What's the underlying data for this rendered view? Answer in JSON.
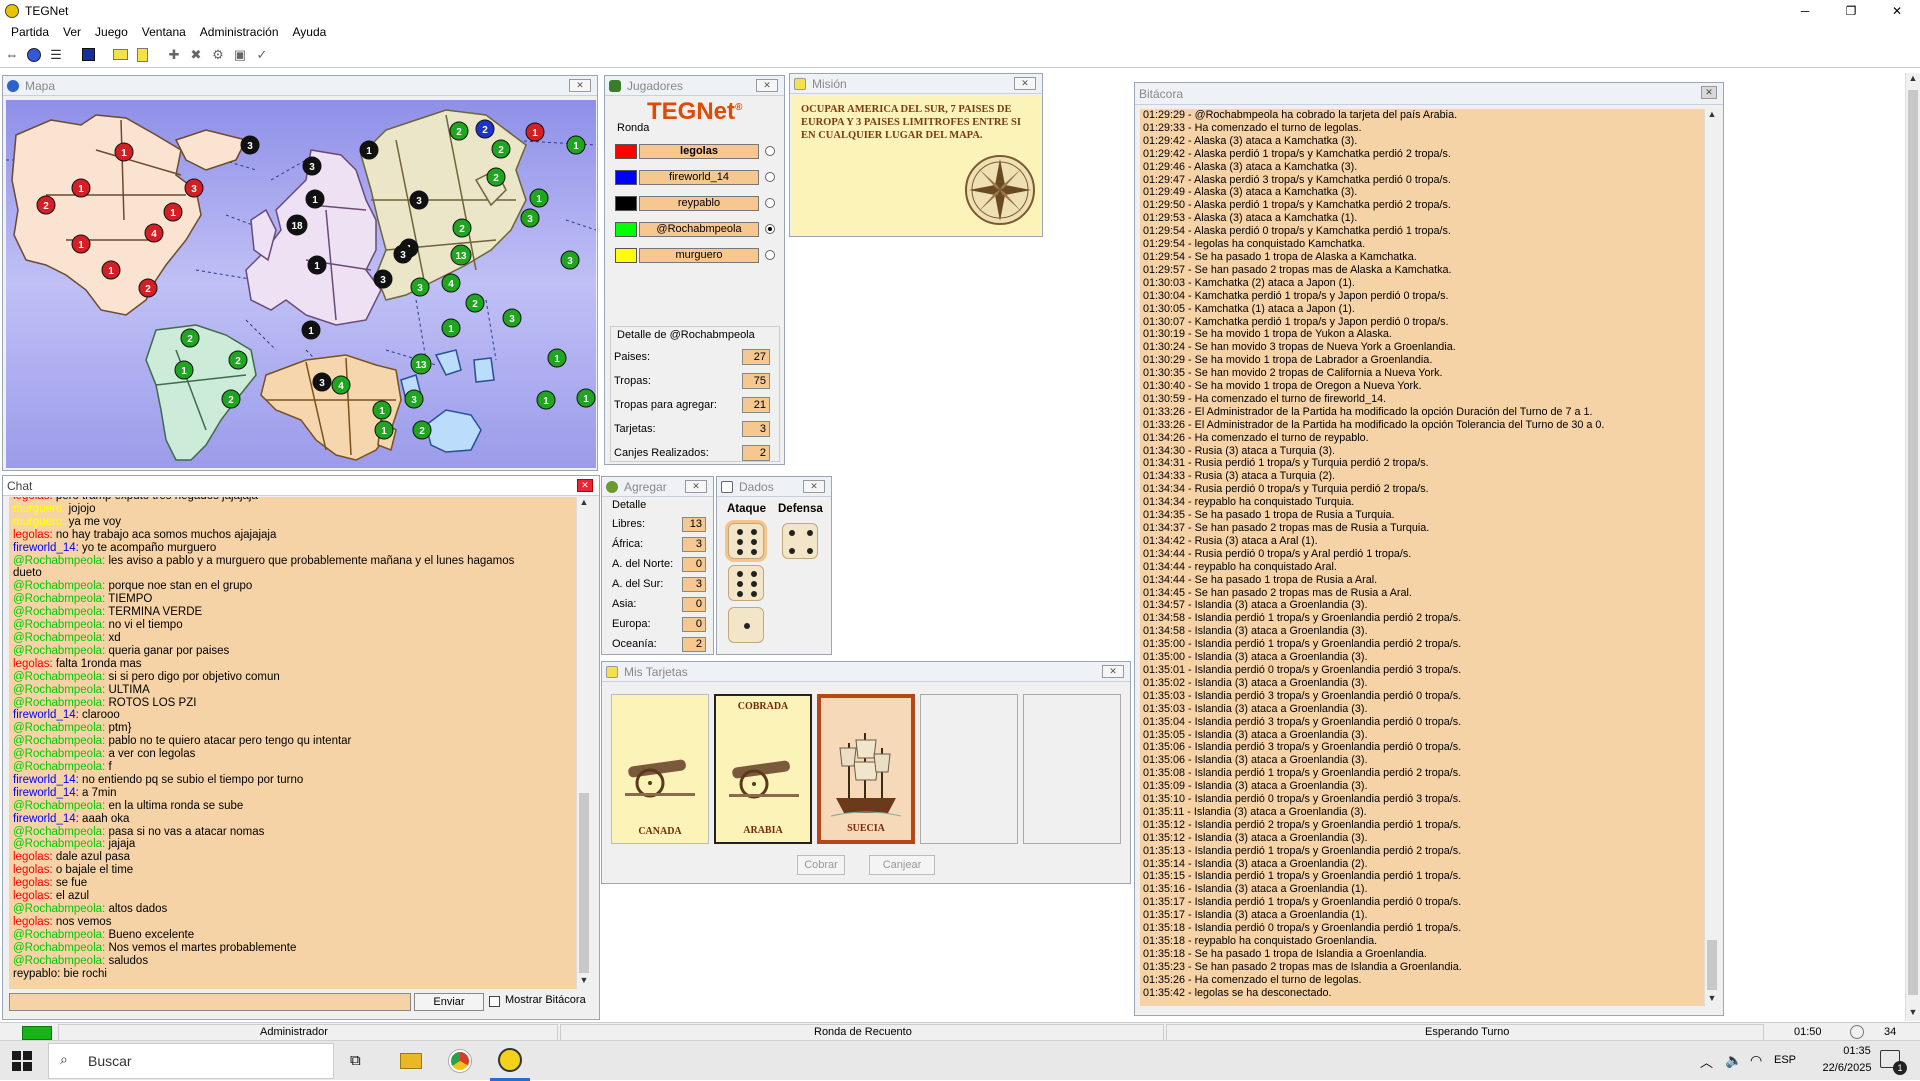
{
  "app": {
    "title": "TEGNet"
  },
  "window_buttons": {
    "minimize": "─",
    "maximize": "❐",
    "close": "✕"
  },
  "menu": [
    "Partida",
    "Ver",
    "Juego",
    "Ventana",
    "Administración",
    "Ayuda"
  ],
  "panels": {
    "map": {
      "title": "Mapa"
    },
    "players": {
      "title": "Jugadores"
    },
    "mission": {
      "title": "Misión"
    },
    "log": {
      "title": "Bitácora"
    },
    "chat": {
      "title": "Chat"
    },
    "add": {
      "title": "Agregar"
    },
    "dice": {
      "title": "Dados"
    },
    "cards": {
      "title": "Mis Tarjetas"
    }
  },
  "players": {
    "round_label": "Ronda",
    "logo": "TEGNet",
    "logo_mark": "®",
    "list": [
      {
        "name": "legolas",
        "color": "#ff0000",
        "bold": true,
        "selected": false
      },
      {
        "name": "fireworld_14",
        "color": "#0000ff",
        "bold": false,
        "selected": false
      },
      {
        "name": "reypablo",
        "color": "#000000",
        "bold": false,
        "selected": false
      },
      {
        "name": "@Rochabmpeola",
        "color": "#00ff00",
        "bold": false,
        "selected": true
      },
      {
        "name": "murguero",
        "color": "#ffff00",
        "bold": false,
        "selected": false
      }
    ],
    "detail_label": "Detalle de @Rochabmpeola",
    "detail": [
      {
        "label": "Paises:",
        "value": "27"
      },
      {
        "label": "Tropas:",
        "value": "75"
      },
      {
        "label": "Tropas para agregar:",
        "value": "21"
      },
      {
        "label": "Tarjetas:",
        "value": "3"
      },
      {
        "label": "Canjes Realizados:",
        "value": "2"
      }
    ]
  },
  "mission": {
    "text": "OCUPAR AMERICA DEL SUR, 7 PAISES DE EUROPA Y 3 PAISES LIMITROFES ENTRE SI EN CUALQUIER LUGAR DEL MAPA."
  },
  "add": {
    "detail_label": "Detalle",
    "rows": [
      {
        "label": "Libres:",
        "value": "13"
      },
      {
        "label": "África:",
        "value": "3"
      },
      {
        "label": "A. del Norte:",
        "value": "0"
      },
      {
        "label": "A. del Sur:",
        "value": "3"
      },
      {
        "label": "Asia:",
        "value": "0"
      },
      {
        "label": "Europa:",
        "value": "0"
      },
      {
        "label": "Oceanía:",
        "value": "2"
      }
    ]
  },
  "dice": {
    "attack_label": "Ataque",
    "defense_label": "Defensa",
    "attack": [
      6,
      6,
      1
    ],
    "defense": [
      4
    ]
  },
  "cards": {
    "items": [
      {
        "name": "CANADA",
        "status": "",
        "type": "cannon"
      },
      {
        "name": "ARABIA",
        "status": "COBRADA",
        "type": "cannon"
      },
      {
        "name": "SUECIA",
        "status": "",
        "type": "ship"
      }
    ],
    "collect_button": "Cobrar",
    "exchange_button": "Canjear"
  },
  "chat": {
    "cut_line": {
      "who": "legolas:",
      "text": "pero tramp exputo tres negados jajajaja",
      "color": "#ff0000"
    },
    "lines": [
      {
        "who": "murguero:",
        "text": "jojojo",
        "color": "#ffff00"
      },
      {
        "who": "murguero:",
        "text": "ya me voy",
        "color": "#ffff00"
      },
      {
        "who": "legolas:",
        "text": "no hay trabajo aca somos muchos ajajajaja",
        "color": "#ff0000"
      },
      {
        "who": "fireworld_14:",
        "text": "yo te acompaño murguero",
        "color": "#0000ff"
      },
      {
        "who": "@Rochabmpeola:",
        "text": "les aviso a pablo y a murguero que probablemente mañana y el lunes hagamos",
        "color": "#00cc00"
      },
      {
        "who": "",
        "text": "dueto",
        "color": "#000000"
      },
      {
        "who": "@Rochabmpeola:",
        "text": "porque noe stan en el grupo",
        "color": "#00cc00"
      },
      {
        "who": "@Rochabmpeola:",
        "text": "TIEMPO",
        "color": "#00cc00"
      },
      {
        "who": "@Rochabmpeola:",
        "text": "TERMINA VERDE",
        "color": "#00cc00"
      },
      {
        "who": "@Rochabmpeola:",
        "text": "no vi el tiempo",
        "color": "#00cc00"
      },
      {
        "who": "@Rochabmpeola:",
        "text": "xd",
        "color": "#00cc00"
      },
      {
        "who": "@Rochabmpeola:",
        "text": "queria ganar por paises",
        "color": "#00cc00"
      },
      {
        "who": "legolas:",
        "text": "falta 1ronda  mas",
        "color": "#ff0000"
      },
      {
        "who": "@Rochabmpeola:",
        "text": "si si pero digo por objetivo comun",
        "color": "#00cc00"
      },
      {
        "who": "@Rochabmpeola:",
        "text": "ULTIMA",
        "color": "#00cc00"
      },
      {
        "who": "@Rochabmpeola:",
        "text": "ROTOS LOS PZI",
        "color": "#00cc00"
      },
      {
        "who": "fireworld_14:",
        "text": "clarooo",
        "color": "#0000ff"
      },
      {
        "who": "@Rochabmpeola:",
        "text": "ptm}",
        "color": "#00cc00"
      },
      {
        "who": "@Rochabmpeola:",
        "text": "pablo no te quiero atacar pero tengo qu intentar",
        "color": "#00cc00"
      },
      {
        "who": "@Rochabmpeola:",
        "text": "a ver con legolas",
        "color": "#00cc00"
      },
      {
        "who": "@Rochabmpeola:",
        "text": "f",
        "color": "#00cc00"
      },
      {
        "who": "fireworld_14:",
        "text": "no entiendo pq se subio el tiempo por turno",
        "color": "#0000ff"
      },
      {
        "who": "fireworld_14:",
        "text": "a 7min",
        "color": "#0000ff"
      },
      {
        "who": "@Rochabmpeola:",
        "text": "en la ultima ronda se sube",
        "color": "#00cc00"
      },
      {
        "who": "fireworld_14:",
        "text": "aaah oka",
        "color": "#0000ff"
      },
      {
        "who": "@Rochabmpeola:",
        "text": "pasa si no vas a atacar nomas",
        "color": "#00cc00"
      },
      {
        "who": "@Rochabmpeola:",
        "text": "jajaja",
        "color": "#00cc00"
      },
      {
        "who": "legolas:",
        "text": "dale azul pasa",
        "color": "#ff0000"
      },
      {
        "who": "legolas:",
        "text": "o bajale el time",
        "color": "#ff0000"
      },
      {
        "who": "legolas:",
        "text": "se fue",
        "color": "#ff0000"
      },
      {
        "who": "legolas:",
        "text": "el azul",
        "color": "#ff0000"
      },
      {
        "who": "@Rochabmpeola:",
        "text": "altos dados",
        "color": "#00cc00"
      },
      {
        "who": "legolas:",
        "text": "nos vemos",
        "color": "#ff0000"
      },
      {
        "who": "@Rochabmpeola:",
        "text": "Bueno excelente",
        "color": "#00cc00"
      },
      {
        "who": "@Rochabmpeola:",
        "text": "Nos vemos el martes probablemente",
        "color": "#00cc00"
      },
      {
        "who": "@Rochabmpeola:",
        "text": "saludos",
        "color": "#00cc00"
      },
      {
        "who": "reypablo:",
        "text": "bie rochi",
        "color": "#000000"
      }
    ],
    "input_value": "",
    "send_button": "Enviar",
    "show_log_label": "Mostrar Bitácora"
  },
  "log": {
    "lines": [
      "01:29:29 - @Rochabmpeola ha cobrado la tarjeta del país Arabia.",
      "01:29:33 - Ha comenzado el turno de legolas.",
      "01:29:42 - Alaska (3) ataca a Kamchatka (3).",
      "01:29:42 - Alaska perdió 1 tropa/s y Kamchatka perdió 2 tropa/s.",
      "01:29:46 - Alaska (3) ataca a Kamchatka (3).",
      "01:29:47 - Alaska perdió 3 tropa/s y Kamchatka perdió 0 tropa/s.",
      "01:29:49 - Alaska (3) ataca a Kamchatka (3).",
      "01:29:50 - Alaska perdió 1 tropa/s y Kamchatka perdió 2 tropa/s.",
      "01:29:53 - Alaska (3) ataca a Kamchatka (1).",
      "01:29:54 - Alaska perdió 0 tropa/s y Kamchatka perdió 1 tropa/s.",
      "01:29:54 - legolas ha conquistado Kamchatka.",
      "01:29:54 - Se ha pasado 1 tropa de Alaska a Kamchatka.",
      "01:29:57 - Se han pasado 2 tropas mas de Alaska a Kamchatka.",
      "01:30:03 - Kamchatka (2) ataca a Japon (1).",
      "01:30:04 - Kamchatka perdió 1 tropa/s y Japon perdió 0 tropa/s.",
      "01:30:05 - Kamchatka (1) ataca a Japon (1).",
      "01:30:07 - Kamchatka perdió 1 tropa/s y Japon perdió 0 tropa/s.",
      "01:30:19 - Se ha movido 1 tropa de Yukon a Alaska.",
      "01:30:24 - Se han movido 3 tropas de Nueva York a Groenlandia.",
      "01:30:29 - Se ha movido 1 tropa de Labrador a Groenlandia.",
      "01:30:35 - Se han movido 2 tropas de California a Nueva York.",
      "01:30:40 - Se ha movido 1 tropa de Oregon a Nueva York.",
      "01:30:59 - Ha comenzado el turno de fireworld_14.",
      "01:33:26 - El Administrador de la Partida ha modificado la opción Duración del Turno de 7 a 1.",
      "01:33:26 - El Administrador de la Partida ha modificado la opción Tolerancia del Turno de 30 a 0.",
      "01:34:26 - Ha comenzado el turno de reypablo.",
      "01:34:30 - Rusia (3) ataca a Turquia (3).",
      "01:34:31 - Rusia perdió 1 tropa/s y Turquia perdió 2 tropa/s.",
      "01:34:33 - Rusia (3) ataca a Turquia (2).",
      "01:34:34 - Rusia perdió 0 tropa/s y Turquia perdió 2 tropa/s.",
      "01:34:34 - reypablo ha conquistado Turquia.",
      "01:34:35 - Se ha pasado 1 tropa de Rusia a Turquia.",
      "01:34:37 - Se han pasado 2 tropas mas de Rusia a Turquia.",
      "01:34:42 - Rusia (3) ataca a Aral (1).",
      "01:34:44 - Rusia perdió 0 tropa/s y Aral perdió 1 tropa/s.",
      "01:34:44 - reypablo ha conquistado Aral.",
      "01:34:44 - Se ha pasado 1 tropa de Rusia a Aral.",
      "01:34:45 - Se han pasado 2 tropas mas de Rusia a Aral.",
      "01:34:57 - Islandia (3) ataca a Groenlandia (3).",
      "01:34:58 - Islandia perdió 1 tropa/s y Groenlandia perdió 2 tropa/s.",
      "01:34:58 - Islandia (3) ataca a Groenlandia (3).",
      "01:35:00 - Islandia perdió 1 tropa/s y Groenlandia perdió 2 tropa/s.",
      "01:35:00 - Islandia (3) ataca a Groenlandia (3).",
      "01:35:01 - Islandia perdió 0 tropa/s y Groenlandia perdió 3 tropa/s.",
      "01:35:02 - Islandia (3) ataca a Groenlandia (3).",
      "01:35:03 - Islandia perdió 3 tropa/s y Groenlandia perdió 0 tropa/s.",
      "01:35:03 - Islandia (3) ataca a Groenlandia (3).",
      "01:35:04 - Islandia perdió 3 tropa/s y Groenlandia perdió 0 tropa/s.",
      "01:35:05 - Islandia (3) ataca a Groenlandia (3).",
      "01:35:06 - Islandia perdió 3 tropa/s y Groenlandia perdió 0 tropa/s.",
      "01:35:06 - Islandia (3) ataca a Groenlandia (3).",
      "01:35:08 - Islandia perdió 1 tropa/s y Groenlandia perdió 2 tropa/s.",
      "01:35:09 - Islandia (3) ataca a Groenlandia (3).",
      "01:35:10 - Islandia perdió 0 tropa/s y Groenlandia perdió 3 tropa/s.",
      "01:35:11 - Islandia (3) ataca a Groenlandia (3).",
      "01:35:12 - Islandia perdió 2 tropa/s y Groenlandia perdió 1 tropa/s.",
      "01:35:12 - Islandia (3) ataca a Groenlandia (3).",
      "01:35:13 - Islandia perdió 1 tropa/s y Groenlandia perdió 2 tropa/s.",
      "01:35:14 - Islandia (3) ataca a Groenlandia (2).",
      "01:35:15 - Islandia perdió 1 tropa/s y Groenlandia perdió 1 tropa/s.",
      "01:35:16 - Islandia (3) ataca a Groenlandia (1).",
      "01:35:17 - Islandia perdió 1 tropa/s y Groenlandia perdió 0 tropa/s.",
      "01:35:17 - Islandia (3) ataca a Groenlandia (1).",
      "01:35:18 - Islandia perdió 0 tropa/s y Groenlandia perdió 1 tropa/s.",
      "01:35:18 - reypablo ha conquistado Groenlandia.",
      "01:35:18 - Se ha pasado 1 tropa de Islandia a Groenlandia.",
      "01:35:23 - Se han pasado 2 tropas mas de Islandia a Groenlandia.",
      "01:35:26 - Ha comenzado el turno de legolas.",
      "01:35:42 - legolas se ha desconectado."
    ]
  },
  "status_bar": {
    "role": "Administrador",
    "round": "Ronda de Recuento",
    "state": "Esperando Turno",
    "timer": "01:50",
    "count": "34"
  },
  "taskbar": {
    "search_placeholder": "Buscar",
    "lang": "ESP",
    "time": "01:35",
    "date": "22/6/2025",
    "notif": "1"
  },
  "map": {
    "colors": {
      "red": "#d31f26",
      "black": "#111111",
      "green": "#1fa51f",
      "blue": "#1d33c9"
    },
    "continent_fills": {
      "north_america": "#fae3d0",
      "south_america": "#cdebd9",
      "europe": "#efe1f4",
      "africa": "#f6d6ad",
      "asia": "#ece6c8",
      "oceania": "#bcdcfb"
    },
    "markers": [
      {
        "v": "1",
        "c": "red"
      },
      {
        "v": "2",
        "c": "red"
      },
      {
        "v": "1",
        "c": "red"
      },
      {
        "v": "3",
        "c": "red"
      },
      {
        "v": "1",
        "c": "red"
      },
      {
        "v": "4",
        "c": "red"
      },
      {
        "v": "1",
        "c": "red"
      },
      {
        "v": "1",
        "c": "red"
      },
      {
        "v": "2",
        "c": "red"
      },
      {
        "v": "3",
        "c": "black"
      },
      {
        "v": "3",
        "c": "black"
      },
      {
        "v": "1",
        "c": "black"
      },
      {
        "v": "3",
        "c": "black"
      },
      {
        "v": "1",
        "c": "black"
      },
      {
        "v": "1",
        "c": "black"
      },
      {
        "v": "18",
        "c": "black"
      },
      {
        "v": "1",
        "c": "black"
      },
      {
        "v": "3",
        "c": "black"
      },
      {
        "v": "1",
        "c": "black"
      },
      {
        "v": "3",
        "c": "black"
      },
      {
        "v": "3",
        "c": "black"
      },
      {
        "v": "2",
        "c": "green"
      },
      {
        "v": "2",
        "c": "blue"
      },
      {
        "v": "1",
        "c": "red"
      },
      {
        "v": "2",
        "c": "green"
      },
      {
        "v": "1",
        "c": "green"
      },
      {
        "v": "2",
        "c": "green"
      },
      {
        "v": "1",
        "c": "green"
      },
      {
        "v": "2",
        "c": "green"
      },
      {
        "v": "13",
        "c": "green"
      },
      {
        "v": "3",
        "c": "green"
      },
      {
        "v": "4",
        "c": "green"
      },
      {
        "v": "3",
        "c": "green"
      },
      {
        "v": "3",
        "c": "green"
      },
      {
        "v": "3",
        "c": "green"
      },
      {
        "v": "2",
        "c": "green"
      },
      {
        "v": "2",
        "c": "green"
      },
      {
        "v": "2",
        "c": "green"
      },
      {
        "v": "1",
        "c": "green"
      },
      {
        "v": "2",
        "c": "green"
      },
      {
        "v": "4",
        "c": "green"
      },
      {
        "v": "13",
        "c": "green"
      },
      {
        "v": "3",
        "c": "green"
      },
      {
        "v": "1",
        "c": "green"
      },
      {
        "v": "1",
        "c": "green"
      },
      {
        "v": "2",
        "c": "green"
      },
      {
        "v": "1",
        "c": "green"
      },
      {
        "v": "1",
        "c": "green"
      },
      {
        "v": "1",
        "c": "green"
      },
      {
        "v": "1",
        "c": "green"
      }
    ]
  }
}
